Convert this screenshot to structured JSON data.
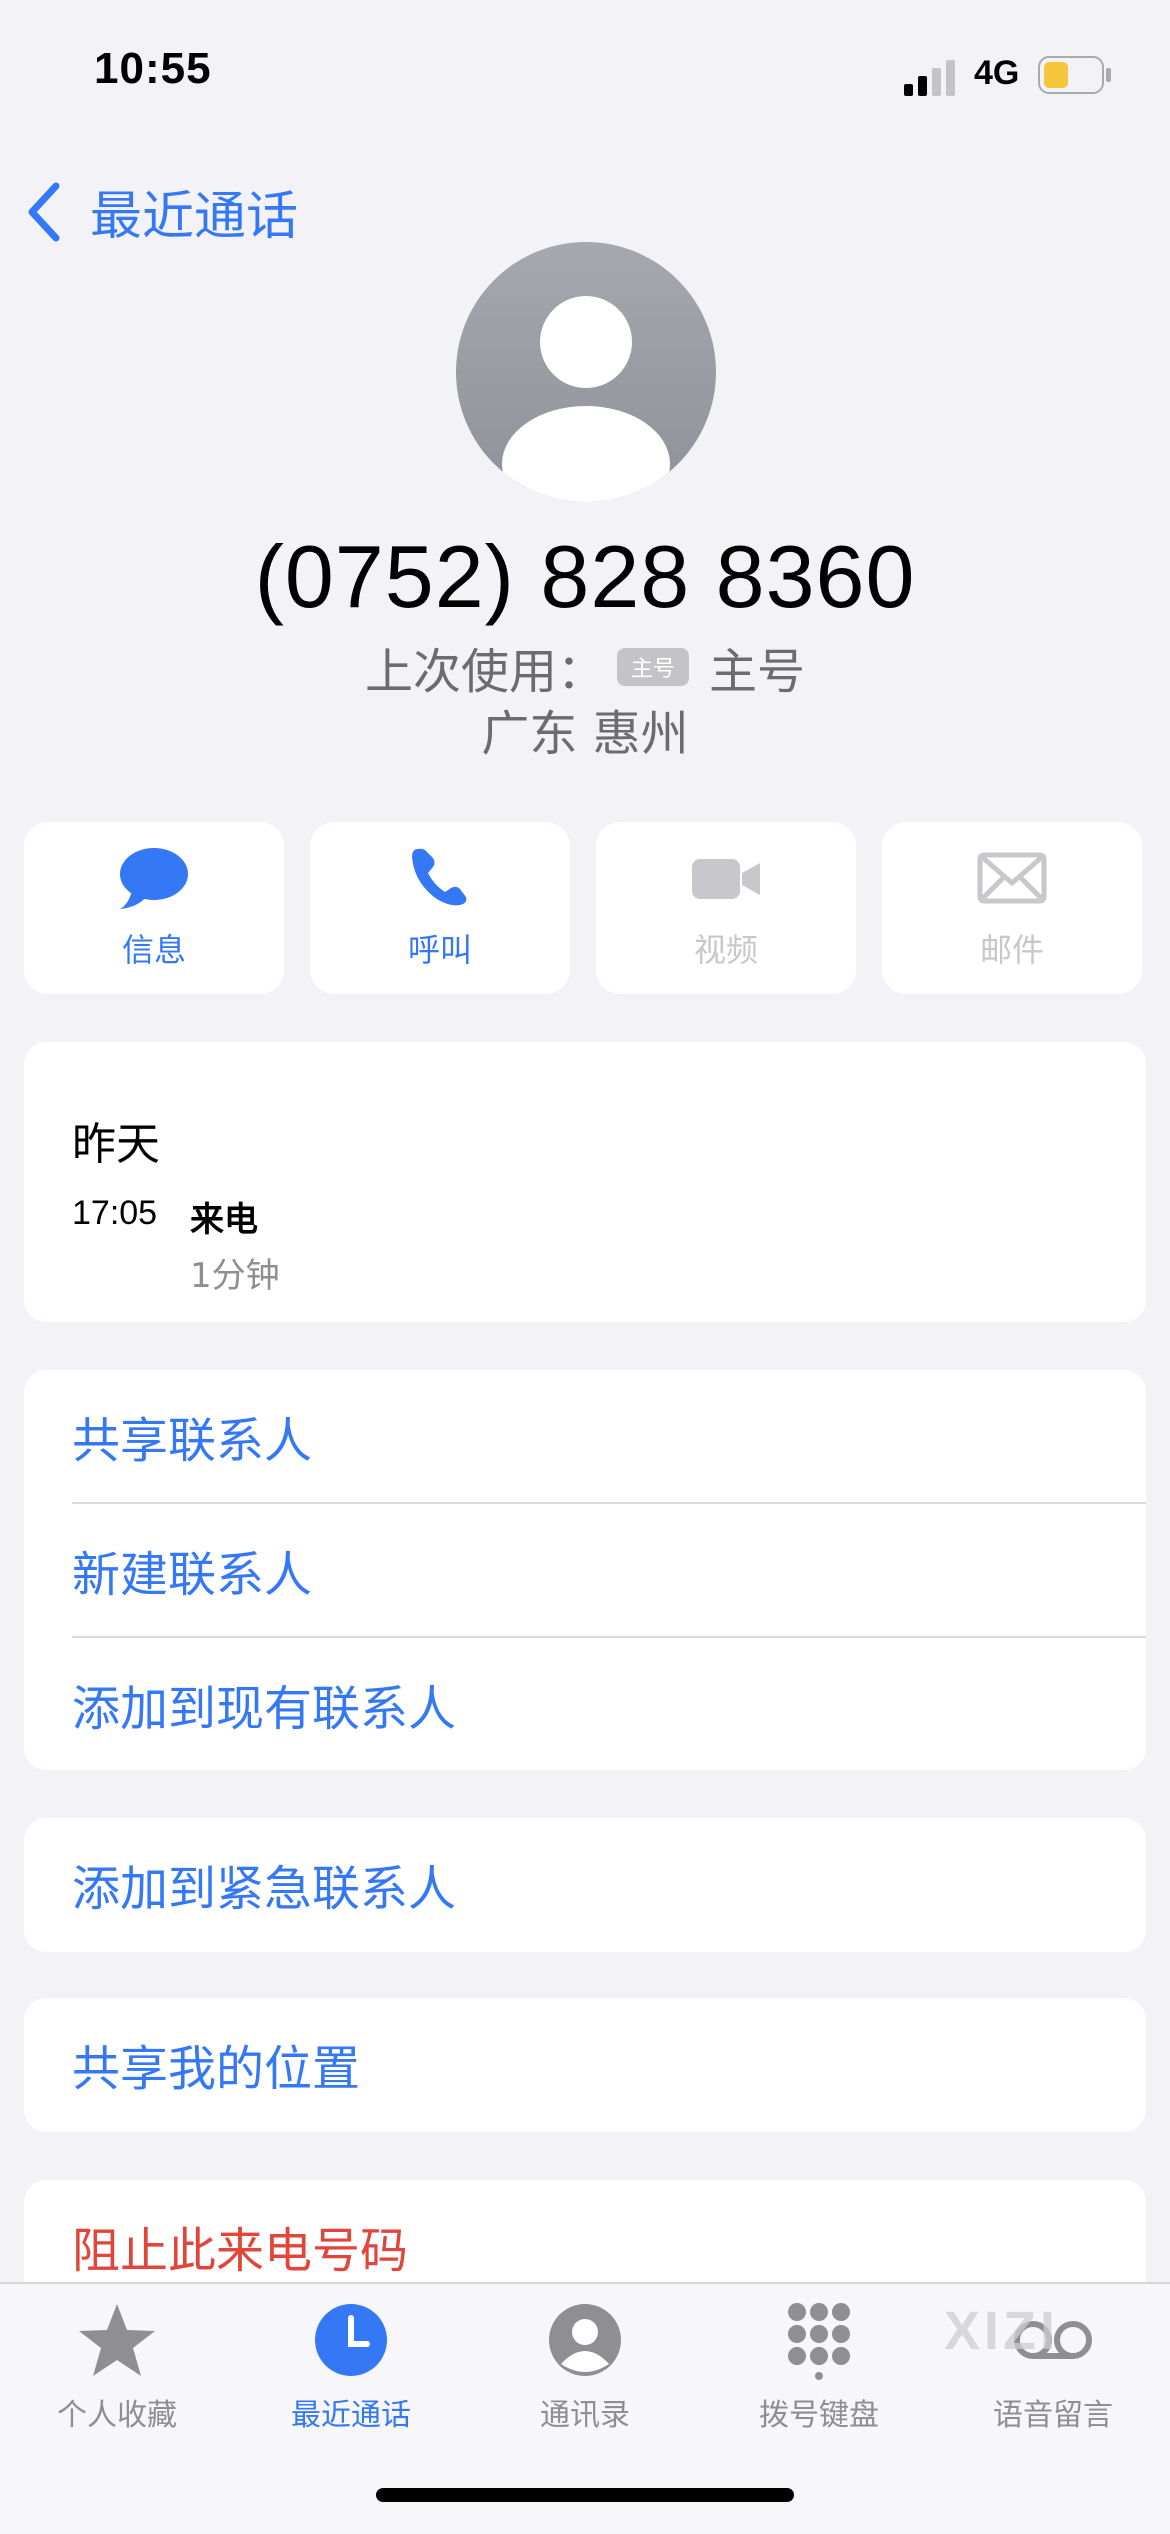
{
  "status_bar": {
    "time": "10:55",
    "network": "4G",
    "battery_color": "#f5c73a"
  },
  "nav": {
    "back_label": "最近通话"
  },
  "contact": {
    "phone_number": "(0752) 828 8360",
    "last_used_label": "上次使用：",
    "sim_badge": "主号",
    "sim_name": "主号",
    "location": "广东 惠州"
  },
  "actions": [
    {
      "label": "信息",
      "icon": "message-icon",
      "enabled": true
    },
    {
      "label": "呼叫",
      "icon": "phone-icon",
      "enabled": true
    },
    {
      "label": "视频",
      "icon": "video-icon",
      "enabled": false
    },
    {
      "label": "邮件",
      "icon": "mail-icon",
      "enabled": false
    }
  ],
  "history": {
    "day": "昨天",
    "time": "17:05",
    "type": "来电",
    "duration": "1分钟"
  },
  "contact_actions": [
    {
      "label": "共享联系人"
    },
    {
      "label": "新建联系人"
    },
    {
      "label": "添加到现有联系人"
    }
  ],
  "emergency": {
    "label": "添加到紧急联系人"
  },
  "share_location": {
    "label": "共享我的位置"
  },
  "block": {
    "label": "阻止此来电号码"
  },
  "tabs": [
    {
      "label": "个人收藏",
      "icon": "star-icon",
      "active": false
    },
    {
      "label": "最近通话",
      "icon": "clock-icon",
      "active": true
    },
    {
      "label": "通讯录",
      "icon": "contacts-icon",
      "active": false
    },
    {
      "label": "拨号键盘",
      "icon": "keypad-icon",
      "active": false
    },
    {
      "label": "语音留言",
      "icon": "voicemail-icon",
      "active": false
    }
  ],
  "watermark": "XIZI",
  "colors": {
    "accent": "#3478f6",
    "destructive": "#e0463a",
    "background": "#f2f2f7"
  }
}
